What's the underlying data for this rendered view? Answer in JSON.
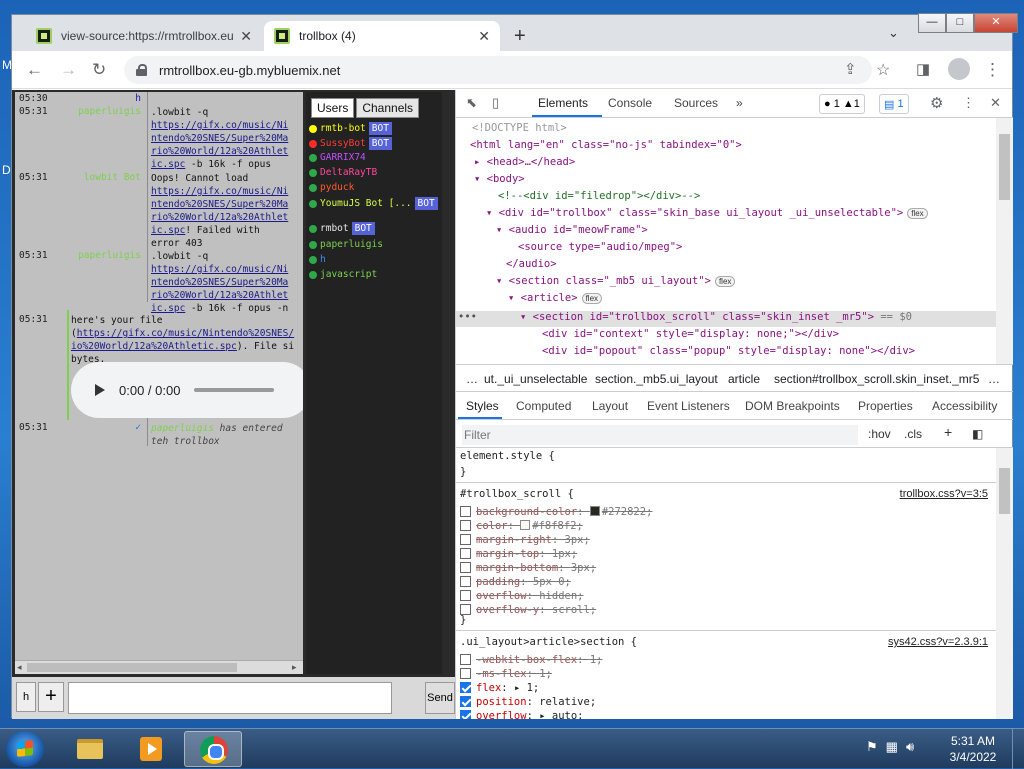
{
  "desktop": {
    "edge_letters": [
      "M",
      "D"
    ]
  },
  "browser": {
    "tabs": [
      {
        "title": "view-source:https://rmtrollbox.eu",
        "active": false
      },
      {
        "title": "trollbox (4)",
        "active": true
      }
    ],
    "new_tab": "+",
    "tab_menu": "⌄",
    "window_controls": {
      "minimize": "—",
      "maximize": "□",
      "close": "✕"
    },
    "url": "rmtrollbox.eu-gb.mybluemix.net"
  },
  "chat": {
    "messages": [
      {
        "time": "05:30",
        "nick": "h",
        "lines": []
      },
      {
        "time": "05:31",
        "nick": "paperluigis",
        "lines": [
          ".lowbit -q",
          "https://gifx.co/music/Nintendo%20SNES/Super%20Mario%20World/12a%20Athletic.spc",
          "-b 16k -f opus"
        ]
      },
      {
        "time": "05:31",
        "nick": "lowbit Bot",
        "lines": [
          "Oops! Cannot load",
          "https://gifx.co/music/Nintendo%20SNES/Super%20Mario%20World/12a%20Athletic.spc",
          "! Failed with error 403"
        ]
      },
      {
        "time": "05:31",
        "nick": "paperluigis",
        "lines": [
          ".lowbit -q",
          "https://gifx.co/music/Nintendo%20SNES/Super%20Mario%20World/12a%20Athletic.spc",
          "-b 16k -f opus -n"
        ]
      },
      {
        "time": "05:31",
        "nick": "",
        "lines": [
          "here's your file (",
          "https://gifx.co/music/Nintendo%20SNES/Super%20Mario%20World/12a%20Athletic.spc",
          "). File size bytes."
        ]
      },
      {
        "time": "05:31",
        "nick": "",
        "lines": [
          "has entered teh trollbox"
        ]
      }
    ],
    "link_frags": {
      "l1a": "https://gifx.co/music/Ni",
      "l1b": "ntendo%20SNES/Super%20Ma",
      "l1c": "rio%20World/12a%20Athlet",
      "l1d": "ic.spc",
      "t1a": ".lowbit -q",
      "t1b": " -b 16k -f opus",
      "t2a": "Oops! Cannot load",
      "t2b": "! Failed with",
      "t2c": "error 403",
      "t3b": " -b 16k -f opus -n",
      "t4a": "here's your file",
      "t4b": "(",
      "l4a": "https://gifx.co/music/Nintendo%20SNES/",
      "l4b": "io%20World/12a%20Athletic.spc",
      "t4c": "). File si",
      "t4d": "bytes.",
      "t5a": "has entered",
      "t5b": "teh trollbox",
      "nick_paper": "paperluigis",
      "nick_lowbit": "lowbit Bot",
      "nick_h": "h",
      "nick_entered": "paperluigis"
    },
    "audio": {
      "time": "0:00 / 0:00"
    },
    "input_placeholder": "",
    "h_button": "h",
    "plus_button": "+",
    "send_button": "Send"
  },
  "users": {
    "tabs": [
      "Users",
      "Channels"
    ],
    "list": [
      {
        "name": "rmtb-bot",
        "color": "#ffff00",
        "bot": true
      },
      {
        "name": "SussyBot",
        "color": "#ff3b3b",
        "bot": true
      },
      {
        "name": "GARRIX74",
        "color": "#c050ff",
        "bot": false
      },
      {
        "name": "DeltaRayTB",
        "color": "#ff4a9a",
        "bot": false
      },
      {
        "name": "pyduck",
        "color": "#ff5a2a",
        "bot": false
      },
      {
        "name": "YoumuJS Bot [...",
        "color": "#d6ff4a",
        "bot": true
      },
      {
        "name": "rmbot",
        "color": "#e8e8e8",
        "bot": true
      },
      {
        "name": "paperluigis",
        "color": "#7ed04d",
        "bot": false
      },
      {
        "name": "h",
        "color": "#3d8bff",
        "bot": false
      },
      {
        "name": "javascript",
        "color": "#7ed04d",
        "bot": false
      }
    ],
    "bot_label": "BOT"
  },
  "devtools": {
    "tabs": [
      "Elements",
      "Console",
      "Sources"
    ],
    "more": "»",
    "errors": "1",
    "warnings": "1",
    "messages": "1",
    "dom": {
      "doctype": "<!DOCTYPE html>",
      "html_line": "<html lang=\"en\" class=\"no-js\" tabindex=\"0\">",
      "head_line": "<head>…</head>",
      "body_line": "<body>",
      "comment_line": "<!--<div id=\"filedrop\"></div>-->",
      "trollbox_line": "<div id=\"trollbox\" class=\"skin_base ui_layout _ui_unselectable\">",
      "audio_line": "<audio id=\"meowFrame\">",
      "source_line": "<source type=\"audio/mpeg\">",
      "audio_close": "</audio>",
      "section_line": "<section class=\"_mb5 ui_layout\">",
      "article_line": "<article>",
      "selected_line": "<section id=\"trollbox_scroll\" class=\"skin_inset _mr5\">",
      "selected_suffix": "== $0",
      "context_line": "<div id=\"context\" style=\"display: none;\"></div>",
      "popout_line": "<div id=\"popout\" class=\"popup\" style=\"display: none\"></div>",
      "flex_chip": "flex",
      "ellipsis": "•••"
    },
    "breadcrumbs": [
      "…",
      "ut._ui_unselectable",
      "section._mb5.ui_layout",
      "article",
      "section#trollbox_scroll.skin_inset._mr5",
      "…"
    ],
    "style_tabs": [
      "Styles",
      "Computed",
      "Layout",
      "Event Listeners",
      "DOM Breakpoints",
      "Properties",
      "Accessibility"
    ],
    "filter_placeholder": "Filter",
    "hov": ":hov",
    "cls": ".cls",
    "rules": {
      "element_style": "element.style {",
      "close": "}",
      "r1_selector": "#trollbox_scroll {",
      "r1_source": "trollbox.css?v=3:5",
      "r1_props": [
        {
          "name": "background-color",
          "value": "#272822",
          "swatch": "#272822"
        },
        {
          "name": "color",
          "value": "#f8f8f2",
          "swatch": "#f8f8f2"
        },
        {
          "name": "margin-right",
          "value": "3px"
        },
        {
          "name": "margin-top",
          "value": "1px"
        },
        {
          "name": "margin-bottom",
          "value": "3px"
        },
        {
          "name": "padding",
          "value": "5px 0"
        },
        {
          "name": "overflow",
          "value": "hidden"
        },
        {
          "name": "overflow-y",
          "value": "scroll"
        }
      ],
      "r2_selector": ".ui_layout>article>section {",
      "r2_source": "sys42.css?v=2.3.9:1",
      "r2_props": [
        {
          "name": "-webkit-box-flex",
          "value": "1",
          "checked": false,
          "struck": true
        },
        {
          "name": "-ms-flex",
          "value": "1",
          "checked": false,
          "struck": true
        },
        {
          "name": "flex",
          "value": "▸ 1",
          "checked": true,
          "struck": false
        },
        {
          "name": "position",
          "value": "relative",
          "checked": true,
          "struck": false
        },
        {
          "name": "overflow",
          "value": "▸ auto",
          "checked": true,
          "struck": false
        }
      ]
    }
  },
  "taskbar": {
    "time": "5:31 AM",
    "date": "3/4/2022"
  }
}
